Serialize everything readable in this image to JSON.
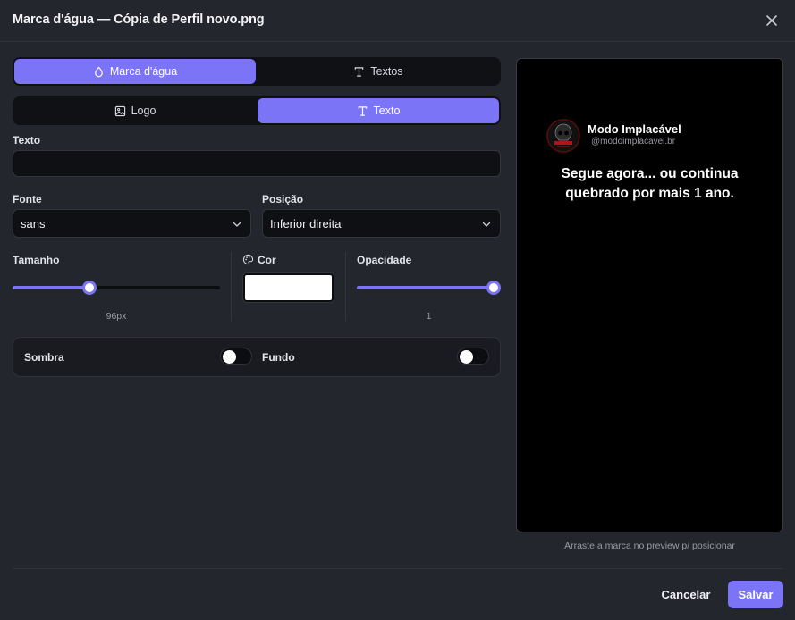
{
  "dialog": {
    "title": "Marca d'água — Cópia de Perfil novo.png"
  },
  "mode_tabs": [
    {
      "label": "Marca d'água",
      "icon": "droplet-icon",
      "active": true
    },
    {
      "label": "Textos",
      "icon": "type-icon",
      "active": false
    }
  ],
  "kind_tabs": [
    {
      "label": "Logo",
      "icon": "image-icon",
      "active": false
    },
    {
      "label": "Texto",
      "icon": "type-icon",
      "active": true
    }
  ],
  "text_field": {
    "label": "Texto",
    "value": ""
  },
  "font_field": {
    "label": "Fonte",
    "value": "sans"
  },
  "position_field": {
    "label": "Posição",
    "value": "Inferior direita"
  },
  "size_slider": {
    "label": "Tamanho",
    "value_label": "96px",
    "fraction": 0.36
  },
  "color_field": {
    "label": "Cor",
    "value": "#ffffff"
  },
  "opacity_slider": {
    "label": "Opacidade",
    "value_label": "1",
    "fraction": 1.0
  },
  "toggles": {
    "shadow": {
      "label": "Sombra",
      "on": false
    },
    "background": {
      "label": "Fundo",
      "on": false
    }
  },
  "preview": {
    "name": "Modo Implacável",
    "handle": "@modoimplacavel.br",
    "text": "Segue agora... ou continua\nquebrado por mais 1 ano.",
    "hint": "Arraste a marca no preview p/ posicionar"
  },
  "footer": {
    "cancel_label": "Cancelar",
    "save_label": "Salvar"
  },
  "colors": {
    "accent": "#7c74f7",
    "background": "#24262d",
    "input_bg": "#0f1014"
  }
}
